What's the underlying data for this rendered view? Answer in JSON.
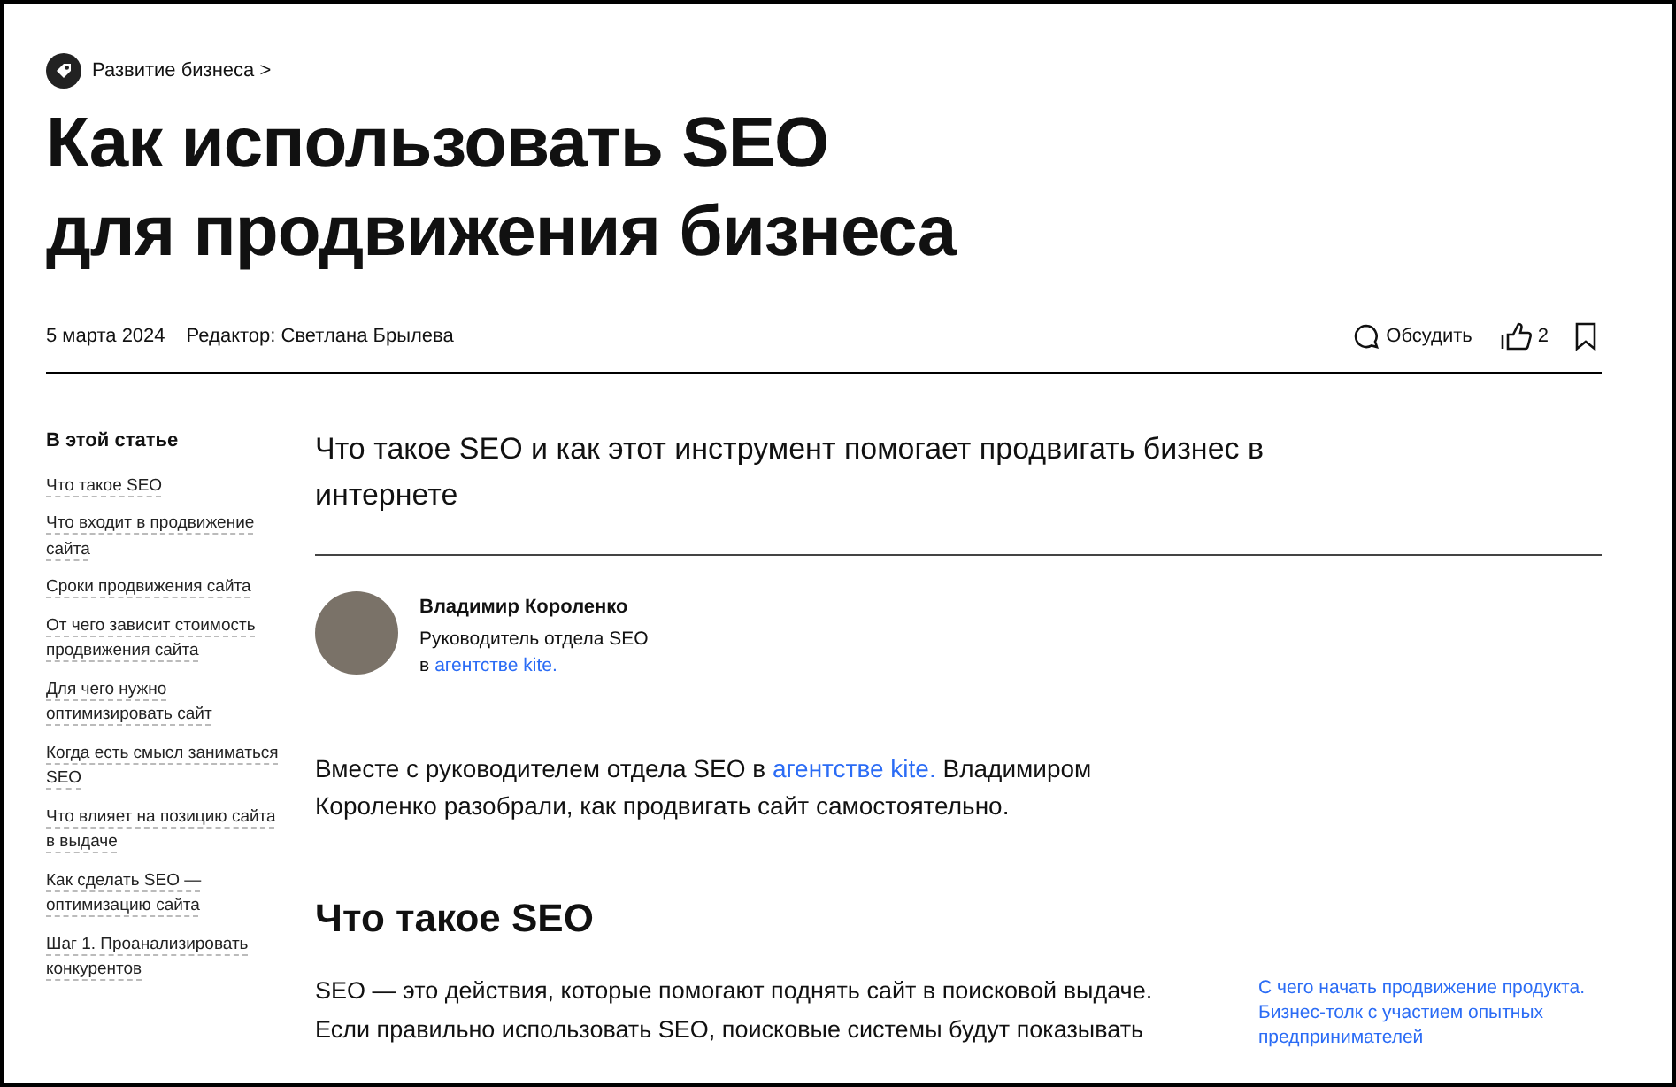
{
  "breadcrumb": {
    "label": "Развитие бизнеса",
    "chevron": ">"
  },
  "title": [
    "Как использовать SEO",
    "для продвижения бизнеса"
  ],
  "meta": {
    "date": "5 марта 2024",
    "editor": "Редактор: Светлана Брылева",
    "discuss": "Обсудить",
    "likes": "2"
  },
  "toc": {
    "heading": "В этой статье",
    "items": [
      {
        "label": "Что такое SEO"
      },
      {
        "label": "Что входит в продвижение сайта"
      },
      {
        "label": "Сроки продвижения сайта"
      },
      {
        "label": "От чего зависит стоимость продвижения сайта"
      },
      {
        "label": "Для чего нужно оптимизировать сайт"
      },
      {
        "label": "Когда есть смысл заниматься SEO"
      },
      {
        "label": "Что влияет на позицию сайта в выдаче"
      },
      {
        "label": "Как сделать SEO — оптимизацию сайта"
      },
      {
        "label": "Шаг 1. Проанализировать конкурентов"
      }
    ]
  },
  "lead": "Что такое SEO и как этот инструмент помогает продвигать бизнес в интернете",
  "author": {
    "name": "Владимир Короленко",
    "role": "Руководитель отдела SEO",
    "prefix": "в",
    "link": "агентстве kite."
  },
  "intro": {
    "before": "Вместе с руководителем отдела SEO в",
    "link": "агентстве kite.",
    "after": "Владимиром Короленко разобрали, как продвигать сайт самостоятельно."
  },
  "section_heading": "Что такое SEO",
  "body": "SEO — это действия, которые помогают поднять сайт в поисковой выдаче. Если правильно использовать SEO, поисковые системы будут показывать",
  "aside_link": "С чего начать продвижение продукта. Бизнес-толк с участием опытных предпринимателей"
}
